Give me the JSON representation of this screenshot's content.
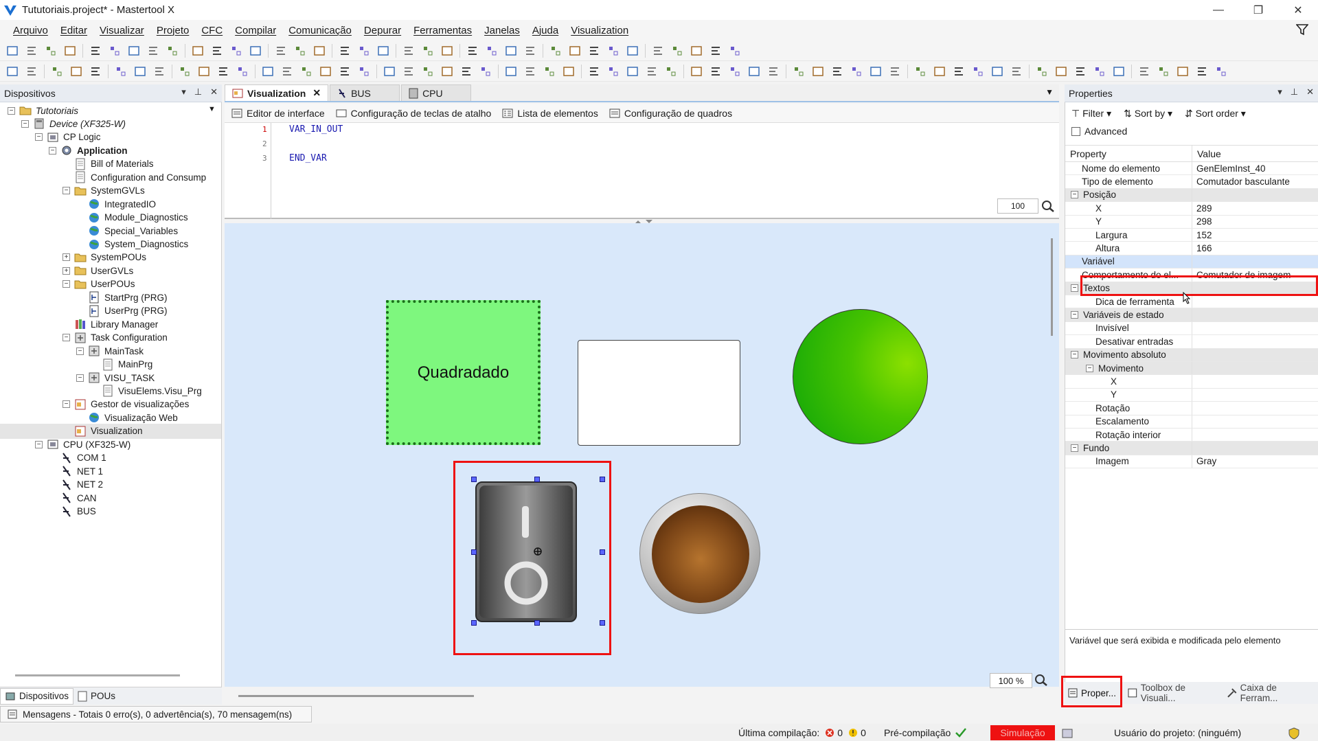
{
  "window": {
    "title": "Tututoriais.project* - Mastertool X",
    "minimize": "—",
    "maximize": "❐",
    "close": "✕"
  },
  "menu": [
    "Arquivo",
    "Editar",
    "Visualizar",
    "Projeto",
    "CFC",
    "Compilar",
    "Comunicação",
    "Depurar",
    "Ferramentas",
    "Janelas",
    "Ajuda",
    "Visualization"
  ],
  "devices": {
    "title": "Dispositivos",
    "tree": [
      {
        "label": "Tutotoriais",
        "style": "italic"
      },
      {
        "label": "Device (XF325-W)",
        "style": "italic"
      },
      {
        "label": "CP Logic",
        "style": ""
      },
      {
        "label": "Application",
        "style": "bold"
      },
      {
        "label": "Bill of Materials",
        "style": ""
      },
      {
        "label": "Configuration and Consump",
        "style": ""
      },
      {
        "label": "SystemGVLs",
        "style": ""
      },
      {
        "label": "IntegratedIO",
        "style": ""
      },
      {
        "label": "Module_Diagnostics",
        "style": ""
      },
      {
        "label": "Special_Variables",
        "style": ""
      },
      {
        "label": "System_Diagnostics",
        "style": ""
      },
      {
        "label": "SystemPOUs",
        "style": ""
      },
      {
        "label": "UserGVLs",
        "style": ""
      },
      {
        "label": "UserPOUs",
        "style": ""
      },
      {
        "label": "StartPrg (PRG)",
        "style": ""
      },
      {
        "label": "UserPrg (PRG)",
        "style": ""
      },
      {
        "label": "Library Manager",
        "style": ""
      },
      {
        "label": "Task Configuration",
        "style": ""
      },
      {
        "label": "MainTask",
        "style": ""
      },
      {
        "label": "MainPrg",
        "style": ""
      },
      {
        "label": "VISU_TASK",
        "style": ""
      },
      {
        "label": "VisuElems.Visu_Prg",
        "style": ""
      },
      {
        "label": "Gestor de visualizações",
        "style": ""
      },
      {
        "label": "Visualização Web",
        "style": ""
      },
      {
        "label": "Visualization",
        "style": ""
      },
      {
        "label": "CPU (XF325-W)",
        "style": ""
      },
      {
        "label": "COM 1",
        "style": ""
      },
      {
        "label": "NET 1",
        "style": ""
      },
      {
        "label": "NET 2",
        "style": ""
      },
      {
        "label": "CAN",
        "style": ""
      },
      {
        "label": "BUS",
        "style": ""
      }
    ],
    "bottom_tabs": [
      "Dispositivos",
      "POUs"
    ]
  },
  "editor": {
    "tabs": [
      "Visualization",
      "BUS",
      "CPU"
    ],
    "subtabs": [
      "Editor de interface",
      "Configuração de teclas de atalho",
      "Lista de elementos",
      "Configuração de quadros"
    ],
    "code_lines": [
      "VAR_IN_OUT",
      "",
      "END_VAR"
    ],
    "line_numbers": [
      "1",
      "2",
      "3"
    ],
    "code_zoom": "100",
    "canvas_zoom": "100 %",
    "rect_label": "Quadradado"
  },
  "properties": {
    "title": "Properties",
    "filter": "Filter",
    "sort_by": "Sort by",
    "sort_order": "Sort order",
    "advanced": "Advanced",
    "col_property": "Property",
    "col_value": "Value",
    "rows": [
      {
        "name": "Nome do elemento",
        "value": "GenElemInst_40",
        "level": 1,
        "cat": false
      },
      {
        "name": "Tipo de elemento",
        "value": "Comutador basculante",
        "level": 1,
        "cat": false
      },
      {
        "name": "Posição",
        "value": "",
        "level": 0,
        "cat": true
      },
      {
        "name": "X",
        "value": "289",
        "level": 2,
        "cat": false
      },
      {
        "name": "Y",
        "value": "298",
        "level": 2,
        "cat": false
      },
      {
        "name": "Largura",
        "value": "152",
        "level": 2,
        "cat": false
      },
      {
        "name": "Altura",
        "value": "166",
        "level": 2,
        "cat": false
      },
      {
        "name": "Variável",
        "value": "",
        "level": 1,
        "cat": false,
        "highlight": true
      },
      {
        "name": "Comportamento do el...",
        "value": "Comutador de imagem",
        "level": 1,
        "cat": false
      },
      {
        "name": "Textos",
        "value": "",
        "level": 0,
        "cat": true
      },
      {
        "name": "Dica de ferramenta",
        "value": "",
        "level": 2,
        "cat": false
      },
      {
        "name": "Variáveis de estado",
        "value": "",
        "level": 0,
        "cat": true
      },
      {
        "name": "Invisível",
        "value": "",
        "level": 2,
        "cat": false
      },
      {
        "name": "Desativar entradas",
        "value": "",
        "level": 2,
        "cat": false
      },
      {
        "name": "Movimento absoluto",
        "value": "",
        "level": 0,
        "cat": true
      },
      {
        "name": "Movimento",
        "value": "",
        "level": 1,
        "cat": true,
        "sub": true
      },
      {
        "name": "X",
        "value": "",
        "level": 3,
        "cat": false
      },
      {
        "name": "Y",
        "value": "",
        "level": 3,
        "cat": false
      },
      {
        "name": "Rotação",
        "value": "",
        "level": 2,
        "cat": false
      },
      {
        "name": "Escalamento",
        "value": "",
        "level": 2,
        "cat": false
      },
      {
        "name": "Rotação interior",
        "value": "",
        "level": 2,
        "cat": false
      },
      {
        "name": "Fundo",
        "value": "",
        "level": 0,
        "cat": true
      },
      {
        "name": "Imagem",
        "value": "Gray",
        "level": 2,
        "cat": false
      }
    ],
    "description": "Variável que será exibida e modificada pelo elemento",
    "bottom_tabs": [
      "Proper...",
      "Toolbox de Visuali...",
      "Caixa de Ferram..."
    ]
  },
  "messages": "Mensagens - Totais 0 erro(s), 0 advertência(s), 70 mensagem(ns)",
  "status": {
    "last_compile": "Última compilação:",
    "errors": "0",
    "warnings": "0",
    "precompile": "Pré-compilação",
    "simulation": "Simulação",
    "user": "Usuário do projeto: (ninguém)"
  },
  "colors": {
    "accent_red": "#ee1111",
    "rect_green": "#7ef77e",
    "canvas_bg": "#d9e8fa"
  }
}
